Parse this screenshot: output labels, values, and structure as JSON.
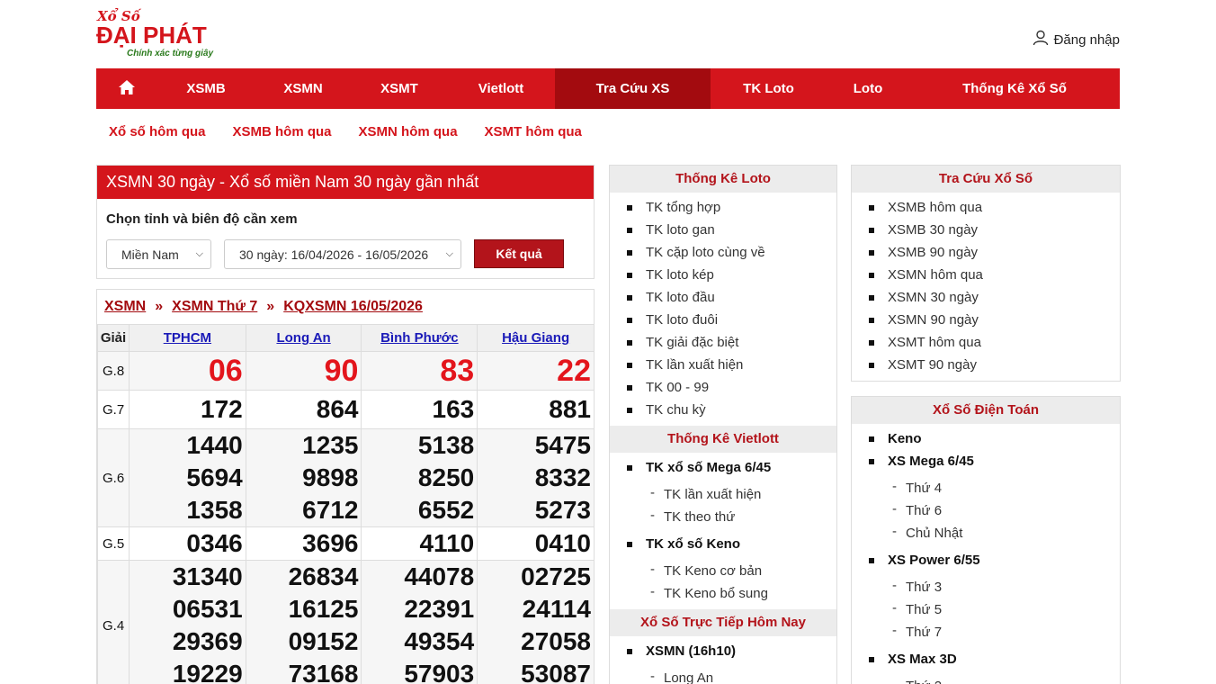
{
  "logo": {
    "line1": "Xổ Số",
    "line2": "ĐẠI PHÁT",
    "tagline": "Chính xác từng giây"
  },
  "header": {
    "login_label": "Đăng nhập"
  },
  "mainnav": {
    "items": [
      {
        "label": "XSMB"
      },
      {
        "label": "XSMN"
      },
      {
        "label": "XSMT"
      },
      {
        "label": "Vietlott"
      },
      {
        "label": "Tra Cứu XS"
      },
      {
        "label": "TK Loto"
      },
      {
        "label": "Loto"
      },
      {
        "label": "Thống Kê Xổ Số"
      }
    ],
    "active": "Tra Cứu XS"
  },
  "subnav": {
    "items": [
      "Xổ số hôm qua",
      "XSMB hôm qua",
      "XSMN hôm qua",
      "XSMT hôm qua"
    ]
  },
  "selector": {
    "title": "XSMN 30 ngày - Xổ số miền Nam 30 ngày gần nhất",
    "label": "Chọn tỉnh và biên độ cần xem",
    "region_value": "Miền Nam",
    "range_value": "30 ngày: 16/04/2026 - 16/05/2026",
    "submit_label": "Kết quả"
  },
  "result": {
    "breadcrumb": [
      "XSMN",
      "XSMN Thứ 7",
      "KQXSMN 16/05/2026"
    ],
    "breadcrumb_sep": "»",
    "col_giai": "Giải",
    "provinces": [
      "TPHCM",
      "Long An",
      "Bình Phước",
      "Hậu Giang"
    ],
    "rows": [
      {
        "giai": "G.8",
        "values": [
          [
            "06"
          ],
          [
            "90"
          ],
          [
            "83"
          ],
          [
            "22"
          ]
        ]
      },
      {
        "giai": "G.7",
        "values": [
          [
            "172"
          ],
          [
            "864"
          ],
          [
            "163"
          ],
          [
            "881"
          ]
        ]
      },
      {
        "giai": "G.6",
        "values": [
          [
            "1440",
            "5694",
            "1358"
          ],
          [
            "1235",
            "9898",
            "6712"
          ],
          [
            "5138",
            "8250",
            "6552"
          ],
          [
            "5475",
            "8332",
            "5273"
          ]
        ]
      },
      {
        "giai": "G.5",
        "values": [
          [
            "0346"
          ],
          [
            "3696"
          ],
          [
            "4110"
          ],
          [
            "0410"
          ]
        ]
      },
      {
        "giai": "G.4",
        "values": [
          [
            "31340",
            "06531",
            "29369",
            "19229"
          ],
          [
            "26834",
            "16125",
            "09152",
            "73168"
          ],
          [
            "44078",
            "22391",
            "49354",
            "57903"
          ],
          [
            "02725",
            "24114",
            "27058",
            "53087"
          ]
        ]
      }
    ]
  },
  "mid": {
    "loto_title": "Thống Kê Loto",
    "loto_items": [
      "TK tổng hợp",
      "TK loto gan",
      "TK cặp loto cùng về",
      "TK loto kép",
      "TK loto đầu",
      "TK loto đuôi",
      "TK giải đặc biệt",
      "TK lần xuất hiện",
      "TK 00 - 99",
      "TK chu kỳ"
    ],
    "vietlott_title": "Thống Kê Vietlott",
    "mega_label": "TK xổ số Mega 6/45",
    "mega_sub": [
      "TK lần xuất hiện",
      "TK theo thứ"
    ],
    "keno_label": "TK xổ số Keno",
    "keno_sub": [
      "TK Keno cơ bản",
      "TK Keno bổ sung"
    ],
    "live_title": "Xổ Số Trực Tiếp Hôm Nay",
    "live_label": "XSMN (16h10)",
    "live_sub": [
      "Long An"
    ]
  },
  "right": {
    "tracuu_title": "Tra Cứu Xổ Số",
    "tracuu_items": [
      "XSMB hôm qua",
      "XSMB 30 ngày",
      "XSMB 90 ngày",
      "XSMN hôm qua",
      "XSMN 30 ngày",
      "XSMN 90 ngày",
      "XSMT hôm qua",
      "XSMT 90 ngày"
    ],
    "dientoan_title": "Xổ Số Điện Toán",
    "keno": "Keno",
    "mega_label": "XS Mega 6/45",
    "mega_days": [
      "Thứ 4",
      "Thứ 6",
      "Chủ Nhật"
    ],
    "power_label": "XS Power 6/55",
    "power_days": [
      "Thứ 3",
      "Thứ 5",
      "Thứ 7"
    ],
    "max3d_label": "XS Max 3D",
    "max3d_days": [
      "Thứ 2"
    ]
  }
}
